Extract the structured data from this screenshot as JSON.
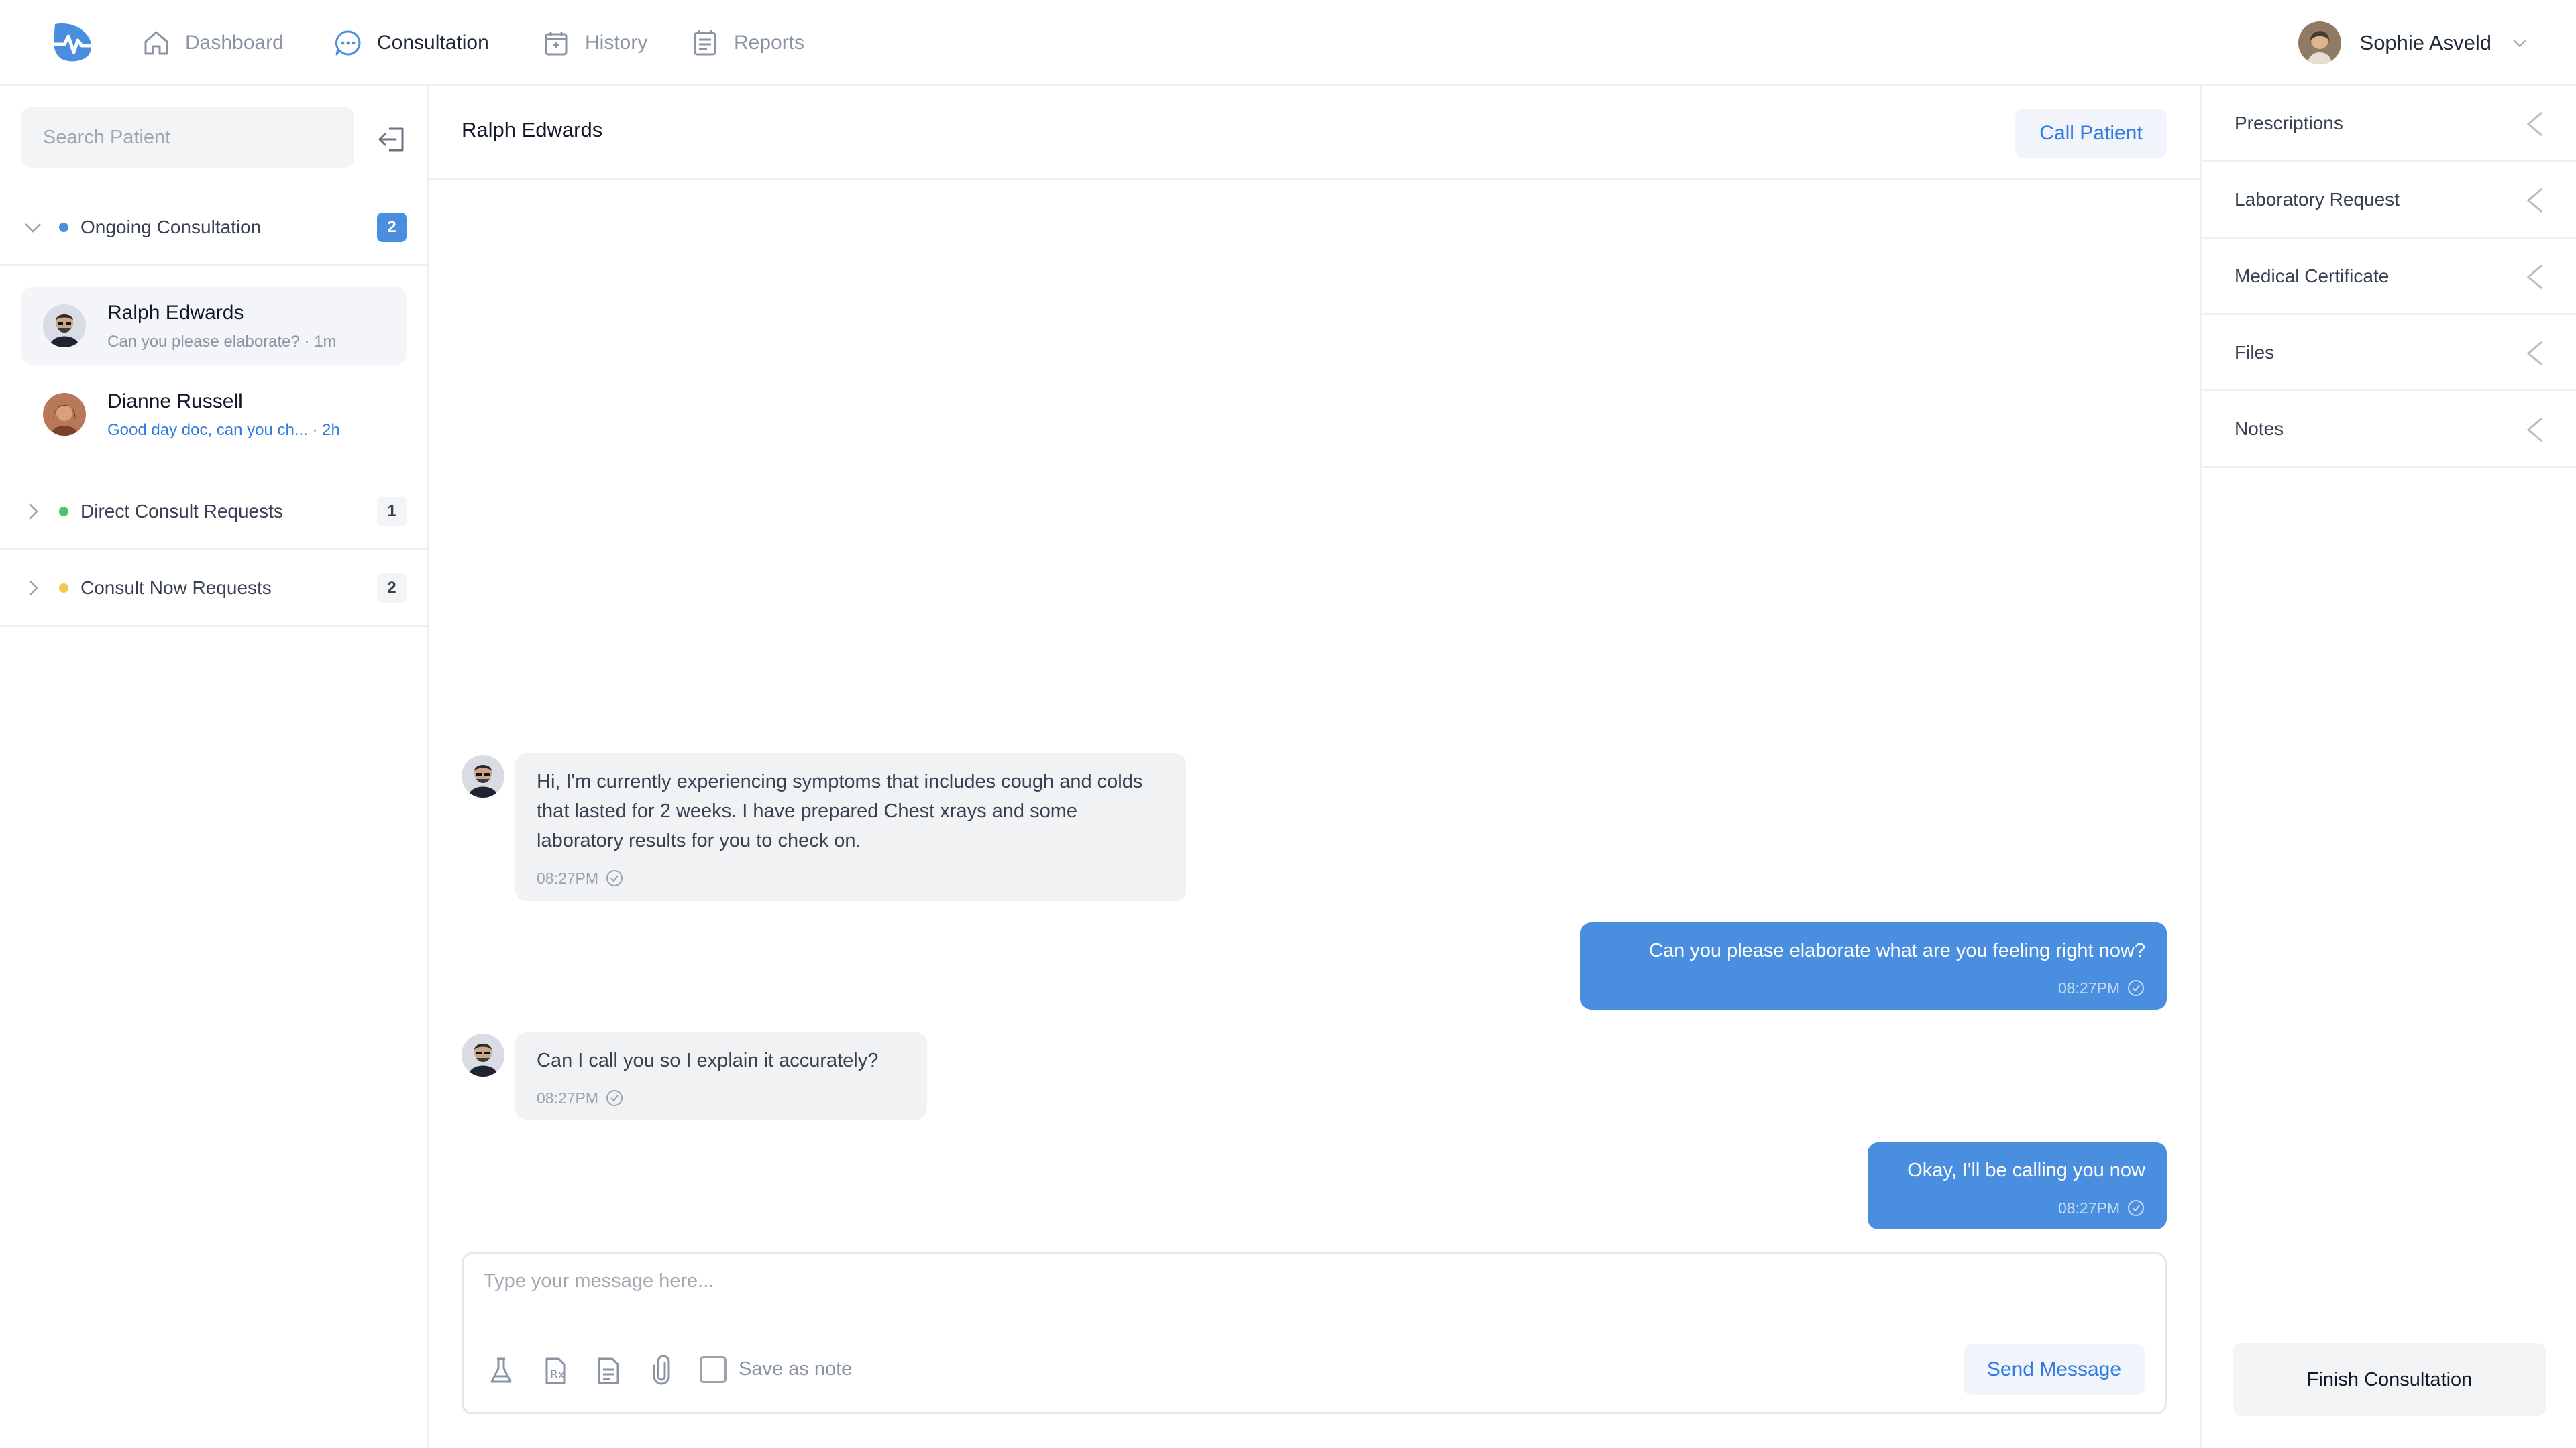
{
  "nav": {
    "logo_icon": "heartbeat-logo-icon",
    "items": [
      {
        "label": "Dashboard",
        "icon": "home-icon",
        "active": false
      },
      {
        "label": "Consultation",
        "icon": "chat-bubble-icon",
        "active": true
      },
      {
        "label": "History",
        "icon": "folder-history-icon",
        "active": false
      },
      {
        "label": "Reports",
        "icon": "report-icon",
        "active": false
      }
    ],
    "user": {
      "name": "Sophie Asveld",
      "icon": "chevron-down-icon"
    }
  },
  "sidebar": {
    "search_placeholder": "Search Patient",
    "signout_icon": "sign-out-icon",
    "sections": [
      {
        "label": "Ongoing Consultation",
        "count": "2",
        "dot_color": "#4a8ee0",
        "expanded": true
      },
      {
        "label": "Direct Consult Requests",
        "count": "1",
        "dot_color": "#4cc46b",
        "expanded": false
      },
      {
        "label": "Consult Now Requests",
        "count": "2",
        "dot_color": "#f2c94c",
        "expanded": false
      }
    ],
    "conversations": [
      {
        "name": "Ralph Edwards",
        "preview": "Can you please elaborate? · 1m",
        "selected": true
      },
      {
        "name": "Dianne Russell",
        "preview": "Good day doc, can you ch... · 2h",
        "selected": false
      }
    ]
  },
  "chat": {
    "patient_name": "Ralph Edwards",
    "call_label": "Call Patient",
    "messages": [
      {
        "direction": "in",
        "text": "Hi, I'm currently experiencing symptoms that includes cough and colds that lasted for 2 weeks. I have prepared Chest xrays and some laboratory results for you to check on.",
        "time": "08:27PM"
      },
      {
        "direction": "out",
        "text": "Can you please elaborate what are you feeling right now?",
        "time": "08:27PM"
      },
      {
        "direction": "in",
        "text": "Can I call you so I explain it accurately?",
        "time": "08:27PM"
      },
      {
        "direction": "out",
        "text": "Okay, I'll be calling you now",
        "time": "08:27PM"
      }
    ],
    "composer": {
      "placeholder": "Type your message here...",
      "tools": [
        "flask-icon",
        "prescription-icon",
        "document-icon",
        "paperclip-icon"
      ],
      "save_note_label": "Save as note",
      "send_label": "Send Message"
    }
  },
  "right_panel": {
    "items": [
      "Prescriptions",
      "Laboratory Request",
      "Medical Certificate",
      "Files",
      "Notes"
    ],
    "finish_label": "Finish Consultation"
  },
  "colors": {
    "accent": "#4a8ee0",
    "link": "#2f7be0"
  }
}
